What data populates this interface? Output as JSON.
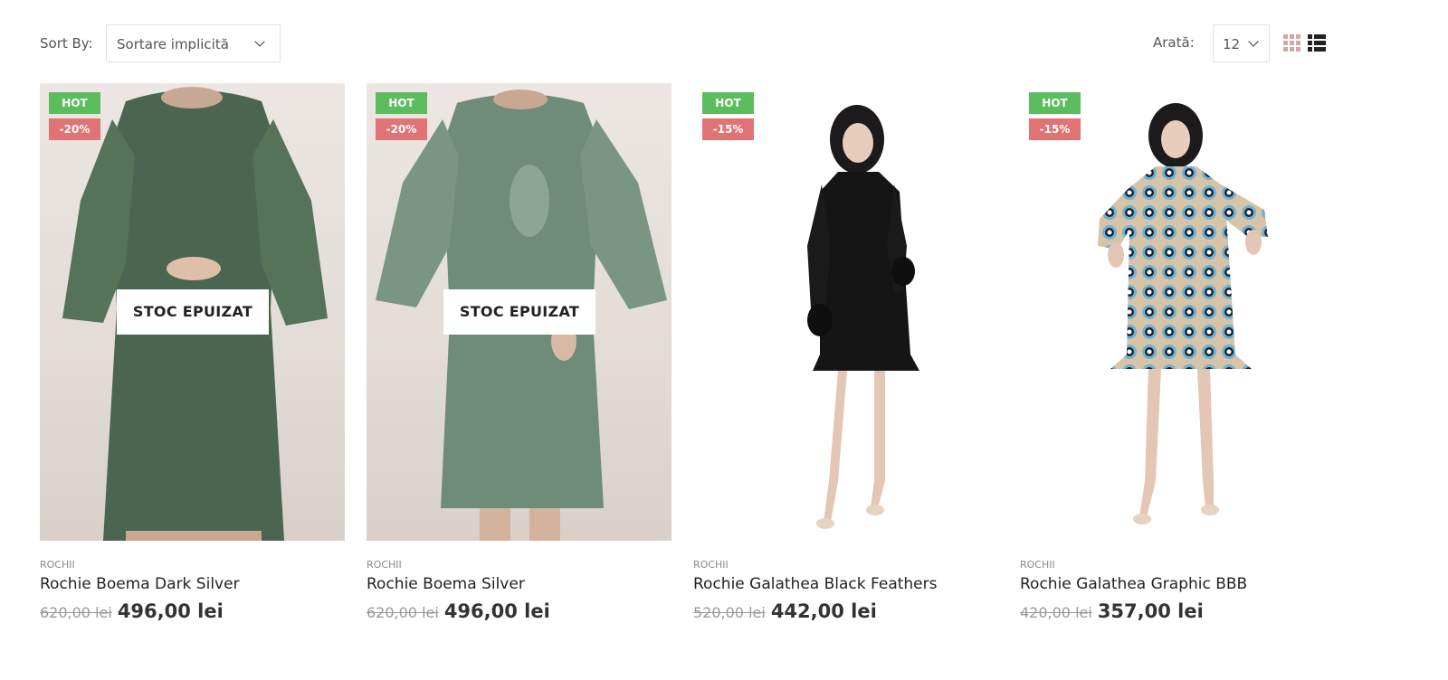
{
  "toolbar": {
    "sort_label": "Sort By:",
    "sort_value": "Sortare implicită",
    "show_label": "Arată:",
    "show_value": "12"
  },
  "products": [
    {
      "badge_hot": "HOT",
      "badge_sale": "-20%",
      "overlay": "STOC EPUIZAT",
      "category": "ROCHII",
      "name": "Rochie Boema Dark Silver",
      "old_price": "620,00 lei",
      "price": "496,00 lei",
      "dress_color": "#4a6650"
    },
    {
      "badge_hot": "HOT",
      "badge_sale": "-20%",
      "overlay": "STOC EPUIZAT",
      "category": "ROCHII",
      "name": "Rochie Boema Silver",
      "old_price": "620,00 lei",
      "price": "496,00 lei",
      "dress_color": "#6f8c78"
    },
    {
      "badge_hot": "HOT",
      "badge_sale": "-15%",
      "category": "ROCHII",
      "name": "Rochie Galathea Black Feathers",
      "old_price": "520,00 lei",
      "price": "442,00 lei",
      "dress_color": "#151515"
    },
    {
      "badge_hot": "HOT",
      "badge_sale": "-15%",
      "category": "ROCHII",
      "name": "Rochie Galathea Graphic BBB",
      "old_price": "420,00 lei",
      "price": "357,00 lei",
      "dress_color": "#6fb3cf"
    }
  ],
  "colors": {
    "hot_badge": "#5bbd5e",
    "sale_badge": "#e07373",
    "grid_view_icon": "#d3a7a7"
  }
}
